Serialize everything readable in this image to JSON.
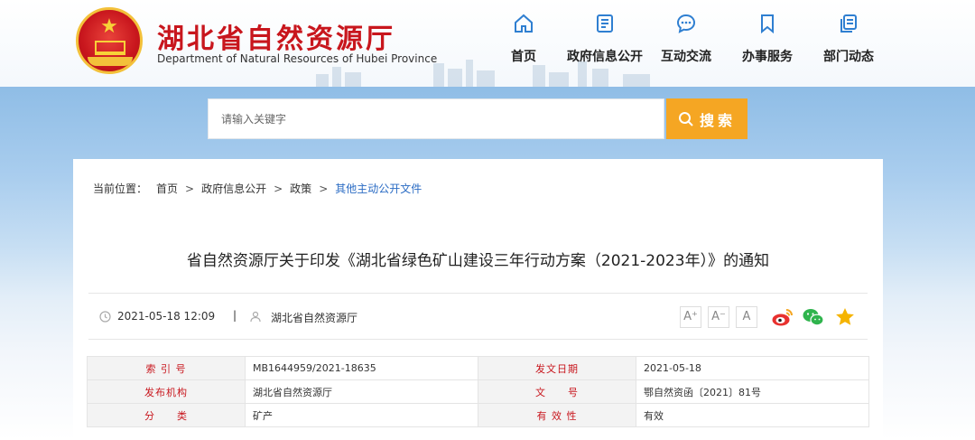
{
  "site": {
    "title": "湖北省自然资源厅",
    "subtitle": "Department of Natural Resources of Hubei Province"
  },
  "nav": [
    {
      "label": "首页",
      "icon": "home-icon"
    },
    {
      "label": "政府信息公开",
      "icon": "document-icon"
    },
    {
      "label": "互动交流",
      "icon": "chat-icon"
    },
    {
      "label": "办事服务",
      "icon": "bookmark-icon"
    },
    {
      "label": "部门动态",
      "icon": "copy-icon"
    }
  ],
  "search": {
    "placeholder": "请输入关键字",
    "button_label": "搜索"
  },
  "breadcrumb": {
    "prefix": "当前位置：",
    "items": [
      "首页",
      "政府信息公开",
      "政策",
      "其他主动公开文件"
    ]
  },
  "document": {
    "title": "省自然资源厅关于印发《湖北省绿色矿山建设三年行动方案（2021-2023年）》的通知",
    "datetime": "2021-05-18 12:09",
    "divider": "|",
    "publisher": "湖北省自然资源厅"
  },
  "font_size_controls": [
    "A⁺",
    "A⁻",
    "A"
  ],
  "share": [
    "weibo-icon",
    "wechat-icon",
    "favorite-star-icon"
  ],
  "info_table": [
    [
      {
        "k": "索 引 号",
        "v": "MB1644959/2021-18635"
      },
      {
        "k": "发文日期",
        "v": "2021-05-18"
      }
    ],
    [
      {
        "k": "发布机构",
        "v": "湖北省自然资源厅"
      },
      {
        "k": "文　　号",
        "v": "鄂自然资函〔2021〕81号"
      }
    ],
    [
      {
        "k": "分　　类",
        "v": "矿产"
      },
      {
        "k": "有 效 性",
        "v": "有效"
      }
    ]
  ],
  "colors": {
    "brand_red": "#c8161d",
    "accent_orange": "#f5a623",
    "link_blue": "#2b6cc4",
    "nav_icon_blue": "#2f7fd1"
  }
}
